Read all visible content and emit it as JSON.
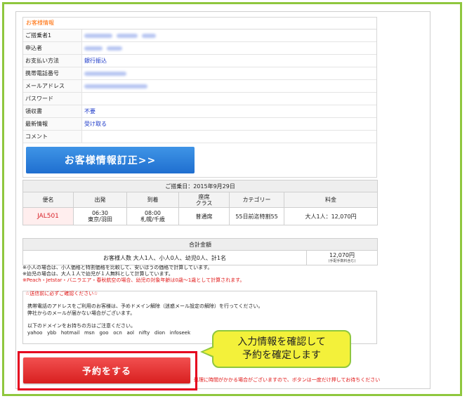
{
  "customer_info": {
    "title": "お客様情報",
    "rows": [
      {
        "label": "ご搭乗者1",
        "value": "",
        "blurred": true
      },
      {
        "label": "申込者",
        "value": "",
        "blurred": true
      },
      {
        "label": "お支払い方法",
        "value": "銀行振込",
        "blurred": false
      },
      {
        "label": "携帯電話番号",
        "value": "",
        "blurred": true
      },
      {
        "label": "メールアドレス",
        "value": "",
        "blurred": true
      },
      {
        "label": "パスワード",
        "value": "",
        "blurred": false
      },
      {
        "label": "領収書",
        "value": "不要",
        "blurred": false
      },
      {
        "label": "最新情報",
        "value": "受け取る",
        "blurred": false
      },
      {
        "label": "コメント",
        "value": "",
        "blurred": false
      }
    ],
    "edit_button": "お客様情報訂正>>"
  },
  "flight": {
    "caption": "ご搭乗日：2015年9月29日",
    "headers": {
      "flight_no": "便名",
      "departure": "出発",
      "arrival": "到着",
      "seat_class": "座席\nクラス",
      "category": "カテゴリー",
      "fare": "料金"
    },
    "row": {
      "flight_no": "JAL501",
      "dep_time": "06:30",
      "dep_place": "東京/羽田",
      "arr_time": "08:00",
      "arr_place": "札幌/千歳",
      "seat_class": "普通席",
      "category": "55日前迄特割55",
      "fare": "大人1人：12,070円"
    }
  },
  "total": {
    "caption": "合計金額",
    "summary": "お客様人数 大人1人、小人0人、幼児0人、計1名",
    "amount": "12,070円",
    "amount_note": "(手配手数料含む)"
  },
  "notes": {
    "line1": "※小人の場合は、小人価格と特割価格を比較して、安いほうの価格で計算しています。",
    "line2": "※幼児の場合は、大人１人で幼児が１人無料として計算しています。",
    "line3": "※Peach・Jetstar・バニラエア・春秋航空の場合、幼児の対象年齢は0歳～1歳として計算されます。"
  },
  "confirm": {
    "title": "☆送信前に必ずご確認ください☆",
    "line1": "携帯電話のアドレスをご利用のお客様は、予めドメイン解除（迷惑メール設定の解除）を行ってください。",
    "line2": "弊社からのメールが届かない場合がございます。",
    "line3": "以下のドメインをお持ちの方はご注意ください。",
    "domains": "yahoo   ybb   hotmail   msn   goo   ocn   aol   nifty   dion   infoseek"
  },
  "callout": {
    "line1": "入力情報を確認して",
    "line2": "予約を確定します"
  },
  "reserve_button": "予約をする",
  "warning": "処理に時間がかかる場合がございますので、ボタンは一度だけ押してお待ちください",
  "colors": {
    "frame_green": "#8fc73e",
    "bubble_yellow": "#f3f13a",
    "edit_blue": "#1f6fd0",
    "reserve_red": "#d81f1f",
    "highlight_red": "#e5001e"
  }
}
